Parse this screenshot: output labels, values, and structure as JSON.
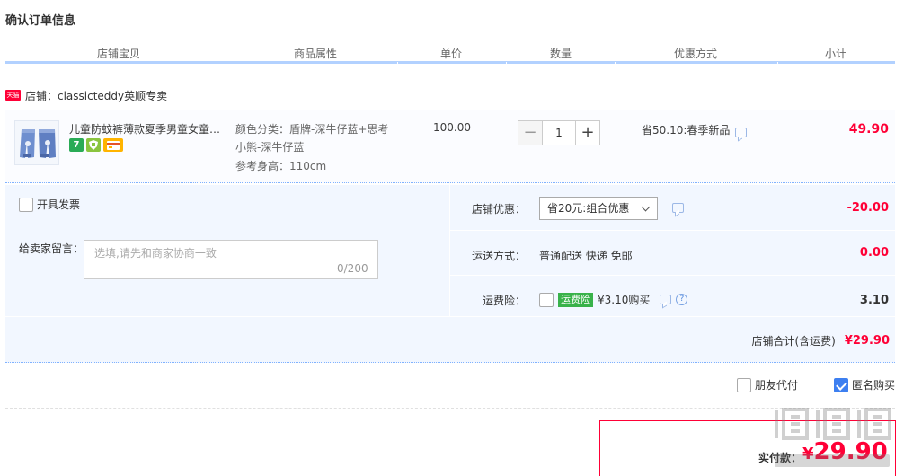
{
  "page": {
    "title": "确认订单信息"
  },
  "columns": [
    "店铺宝贝",
    "商品属性",
    "单价",
    "数量",
    "优惠方式",
    "小计"
  ],
  "shop": {
    "badge": "天猫",
    "label": "店铺：classicteddy英顺专卖"
  },
  "item": {
    "title": "儿童防蚊裤薄款夏季男童女童宝宝裤子",
    "attr_line1": "颜色分类：盾牌-深牛仔蓝+思考",
    "attr_line2": "小熊-深牛仔蓝",
    "attr_line3": "参考身高：110cm",
    "badge_7": "7",
    "price": "100.00",
    "quantity": "1",
    "qty_minus": "−",
    "qty_plus": "+",
    "promotion": "省50.10:春季新品",
    "subtotal": "49.90"
  },
  "invoice": {
    "label": "开具发票"
  },
  "message": {
    "label": "给卖家留言：",
    "placeholder": "选填,请先和商家协商一致",
    "count": "0/200"
  },
  "shop_discount": {
    "label": "店铺优惠：",
    "selected": "省20元:组合优惠",
    "value": "-20.00"
  },
  "shipping": {
    "label": "运送方式：",
    "method": "普通配送 快递 免邮",
    "value": "0.00"
  },
  "insurance": {
    "label": "运费险：",
    "tag": "运费险",
    "price": "¥3.10购买",
    "value": "3.10",
    "help": "?"
  },
  "shop_total": {
    "label": "店铺合计(含运费)",
    "value": "¥29.90"
  },
  "options": {
    "friend_pay": "朋友代付",
    "anonymous": "匿名购买"
  },
  "payment": {
    "label": "实付款：",
    "currency": "¥",
    "amount": "29.90"
  },
  "colors": {
    "accent": "#ff0036",
    "header_line": "#b2d1ff",
    "panel_bg": "#f2f7ff",
    "insurance_tag": "#39b24a",
    "checkbox": "#3d7ff0"
  }
}
